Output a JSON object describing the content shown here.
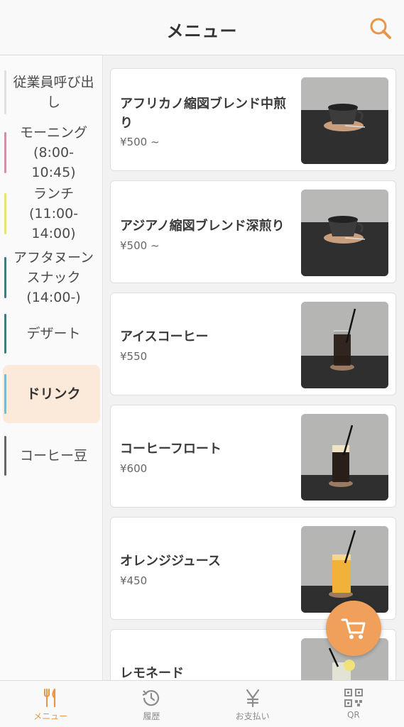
{
  "header": {
    "title": "メニュー"
  },
  "sidebar": {
    "items": [
      {
        "label": "従業員呼び出し",
        "color": "#e0e0e0"
      },
      {
        "label": "モーニング(8:00-10:45)",
        "color": "#d68fa5"
      },
      {
        "label": "ランチ(11:00-14:00)",
        "color": "#ece07a"
      },
      {
        "label": "アフタヌーンスナック(14:00-)",
        "color": "#3f7d80"
      },
      {
        "label": "デザート",
        "color": "#3f7d80"
      },
      {
        "label": "ドリンク",
        "color": "#7fb9c9",
        "active": true
      },
      {
        "label": "コーヒー豆",
        "color": "#666666"
      }
    ]
  },
  "menu": {
    "items": [
      {
        "name": "アフリカノ縮図ブレンド中煎り",
        "price": "¥500 ~",
        "image": "coffee-cup"
      },
      {
        "name": "アジアノ縮図ブレンド深煎り",
        "price": "¥500 ~",
        "image": "coffee-cup"
      },
      {
        "name": "アイスコーヒー",
        "price": "¥550",
        "image": "iced-coffee"
      },
      {
        "name": "コーヒーフロート",
        "price": "¥600",
        "image": "coffee-float"
      },
      {
        "name": "オレンジジュース",
        "price": "¥450",
        "image": "orange-juice"
      },
      {
        "name": "レモネード",
        "price": "",
        "image": "lemonade"
      }
    ]
  },
  "nav": {
    "items": [
      {
        "label": "メニュー",
        "icon": "fork-knife-icon",
        "active": true
      },
      {
        "label": "履歴",
        "icon": "history-icon"
      },
      {
        "label": "お支払い",
        "icon": "yen-icon"
      },
      {
        "label": "QR",
        "icon": "qr-code-icon"
      }
    ]
  },
  "colors": {
    "accent": "#f0a05a",
    "active_bg": "#fbe9d9"
  }
}
